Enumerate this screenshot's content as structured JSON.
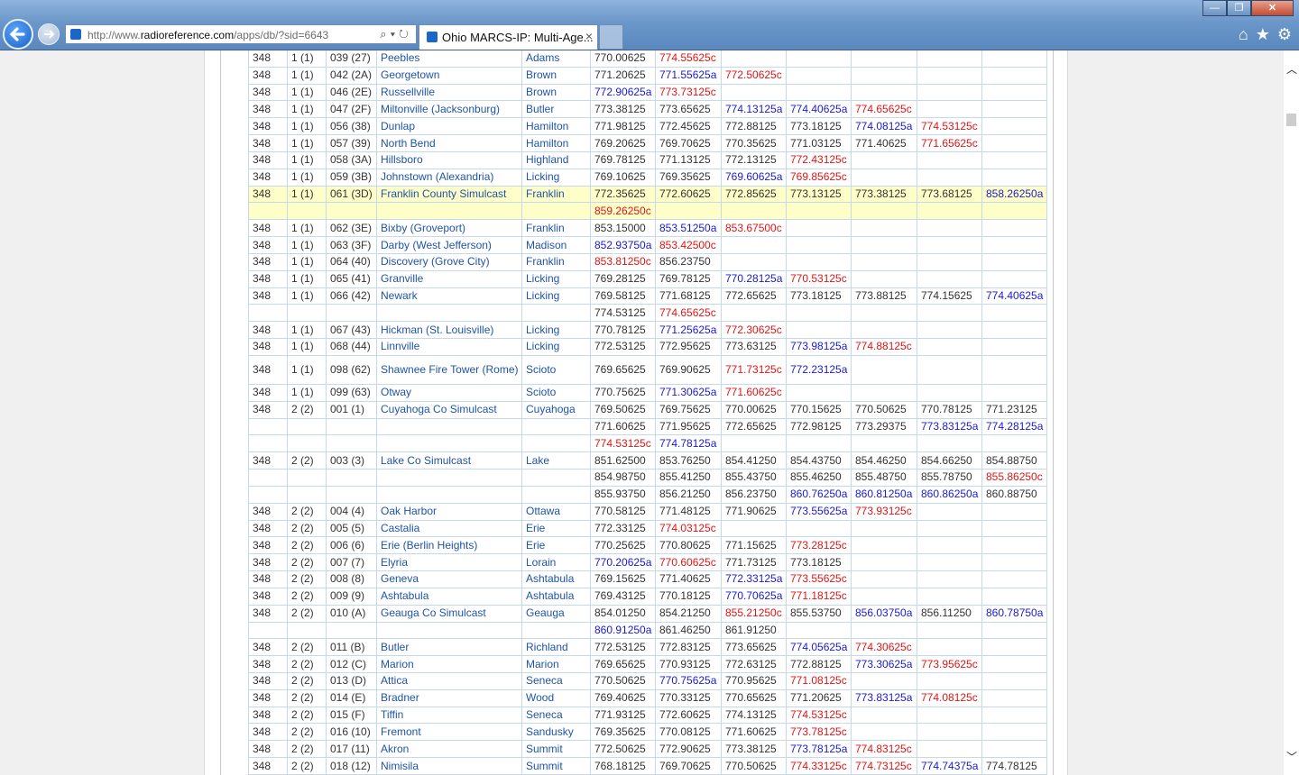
{
  "browser": {
    "url_prefix": "http://www.",
    "url_domain": "radioreference.com",
    "url_path": "/apps/db/?sid=6643",
    "tab_title": "Ohio MARCS-IP: Multi-Age...",
    "tab_close": "×",
    "search_icon": "search-icon",
    "refresh_icon": "refresh-icon",
    "window_min": "—",
    "window_max": "❐",
    "window_close": "✕",
    "tools": {
      "home": "⌂",
      "favorites": "★",
      "settings": "⚙"
    }
  },
  "table_rows": [
    {
      "c": [
        "348",
        "1 (1)",
        "039 (27)",
        "Peebles",
        "Adams",
        "770.00625",
        "774.55625c",
        "",
        "",
        "",
        "",
        ""
      ]
    },
    {
      "c": [
        "348",
        "1 (1)",
        "042 (2A)",
        "Georgetown",
        "Brown",
        "771.20625",
        "771.55625a",
        "772.50625c",
        "",
        "",
        "",
        ""
      ]
    },
    {
      "c": [
        "348",
        "1 (1)",
        "046 (2E)",
        "Russellville",
        "Brown",
        "772.90625a",
        "773.73125c",
        "",
        "",
        "",
        "",
        ""
      ]
    },
    {
      "c": [
        "348",
        "1 (1)",
        "047 (2F)",
        "Miltonville (Jacksonburg)",
        "Butler",
        "773.38125",
        "773.65625",
        "774.13125a",
        "774.40625a",
        "774.65625c",
        "",
        ""
      ]
    },
    {
      "c": [
        "348",
        "1 (1)",
        "056 (38)",
        "Dunlap",
        "Hamilton",
        "771.98125",
        "772.45625",
        "772.88125",
        "773.18125",
        "774.08125a",
        "774.53125c",
        ""
      ]
    },
    {
      "c": [
        "348",
        "1 (1)",
        "057 (39)",
        "North Bend",
        "Hamilton",
        "769.20625",
        "769.70625",
        "770.35625",
        "771.03125",
        "771.40625",
        "771.65625c",
        ""
      ]
    },
    {
      "c": [
        "348",
        "1 (1)",
        "058 (3A)",
        "Hillsboro",
        "Highland",
        "769.78125",
        "771.13125",
        "772.13125",
        "772.43125c",
        "",
        "",
        ""
      ]
    },
    {
      "c": [
        "348",
        "1 (1)",
        "059 (3B)",
        "Johnstown (Alexandria)",
        "Licking",
        "769.10625",
        "769.35625",
        "769.60625a",
        "769.85625c",
        "",
        "",
        ""
      ]
    },
    {
      "hl": true,
      "c": [
        "348",
        "1 (1)",
        "061 (3D)",
        "Franklin County Simulcast",
        "Franklin",
        "772.35625",
        "772.60625",
        "772.85625",
        "773.13125",
        "773.38125",
        "773.68125",
        "858.26250a"
      ]
    },
    {
      "hl": true,
      "c": [
        "",
        "",
        "",
        "",
        "",
        "859.26250c",
        "",
        "",
        "",
        "",
        "",
        ""
      ]
    },
    {
      "c": [
        "348",
        "1 (1)",
        "062 (3E)",
        "Bixby (Groveport)",
        "Franklin",
        "853.15000",
        "853.51250a",
        "853.67500c",
        "",
        "",
        "",
        ""
      ]
    },
    {
      "c": [
        "348",
        "1 (1)",
        "063 (3F)",
        "Darby (West Jefferson)",
        "Madison",
        "852.93750a",
        "853.42500c",
        "",
        "",
        "",
        "",
        ""
      ]
    },
    {
      "c": [
        "348",
        "1 (1)",
        "064 (40)",
        "Discovery (Grove City)",
        "Franklin",
        "853.81250c",
        "856.23750",
        "",
        "",
        "",
        "",
        ""
      ]
    },
    {
      "c": [
        "348",
        "1 (1)",
        "065 (41)",
        "Granville",
        "Licking",
        "769.28125",
        "769.78125",
        "770.28125a",
        "770.53125c",
        "",
        "",
        ""
      ]
    },
    {
      "c": [
        "348",
        "1 (1)",
        "066 (42)",
        "Newark",
        "Licking",
        "769.58125",
        "771.68125",
        "772.65625",
        "773.18125",
        "773.88125",
        "774.15625",
        "774.40625a"
      ]
    },
    {
      "c": [
        "",
        "",
        "",
        "",
        "",
        "774.53125",
        "774.65625c",
        "",
        "",
        "",
        "",
        ""
      ]
    },
    {
      "c": [
        "348",
        "1 (1)",
        "067 (43)",
        "Hickman (St. Louisville)",
        "Licking",
        "770.78125",
        "771.25625a",
        "772.30625c",
        "",
        "",
        "",
        ""
      ]
    },
    {
      "c": [
        "348",
        "1 (1)",
        "068 (44)",
        "Linnville",
        "Licking",
        "772.53125",
        "772.95625",
        "773.63125",
        "773.98125a",
        "774.88125c",
        "",
        ""
      ]
    },
    {
      "tall": true,
      "c": [
        "348",
        "1 (1)",
        "098 (62)",
        "Shawnee Fire Tower (Rome)",
        "Scioto",
        "769.65625",
        "769.90625",
        "771.73125c",
        "772.23125a",
        "",
        "",
        ""
      ]
    },
    {
      "c": [
        "348",
        "1 (1)",
        "099 (63)",
        "Otway",
        "Scioto",
        "770.75625",
        "771.30625a",
        "771.60625c",
        "",
        "",
        "",
        ""
      ]
    },
    {
      "c": [
        "348",
        "2 (2)",
        "001 (1)",
        "Cuyahoga Co Simulcast",
        "Cuyahoga",
        "769.50625",
        "769.75625",
        "770.00625",
        "770.15625",
        "770.50625",
        "770.78125",
        "771.23125"
      ]
    },
    {
      "c": [
        "",
        "",
        "",
        "",
        "",
        "771.60625",
        "771.95625",
        "772.65625",
        "772.98125",
        "773.29375",
        "773.83125a",
        "774.28125a"
      ]
    },
    {
      "c": [
        "",
        "",
        "",
        "",
        "",
        "774.53125c",
        "774.78125a",
        "",
        "",
        "",
        "",
        ""
      ]
    },
    {
      "c": [
        "348",
        "2 (2)",
        "003 (3)",
        "Lake Co Simulcast",
        "Lake",
        "851.62500",
        "853.76250",
        "854.41250",
        "854.43750",
        "854.46250",
        "854.66250",
        "854.88750"
      ]
    },
    {
      "c": [
        "",
        "",
        "",
        "",
        "",
        "854.98750",
        "855.41250",
        "855.43750",
        "855.46250",
        "855.48750",
        "855.78750",
        "855.86250c"
      ]
    },
    {
      "c": [
        "",
        "",
        "",
        "",
        "",
        "855.93750",
        "856.21250",
        "856.23750",
        "860.76250a",
        "860.81250a",
        "860.86250a",
        "860.88750"
      ]
    },
    {
      "c": [
        "348",
        "2 (2)",
        "004 (4)",
        "Oak Harbor",
        "Ottawa",
        "770.58125",
        "771.48125",
        "771.90625",
        "773.55625a",
        "773.93125c",
        "",
        ""
      ]
    },
    {
      "c": [
        "348",
        "2 (2)",
        "005 (5)",
        "Castalia",
        "Erie",
        "772.33125",
        "774.03125c",
        "",
        "",
        "",
        "",
        ""
      ]
    },
    {
      "c": [
        "348",
        "2 (2)",
        "006 (6)",
        "Erie (Berlin Heights)",
        "Erie",
        "770.25625",
        "770.80625",
        "771.15625",
        "773.28125c",
        "",
        "",
        ""
      ]
    },
    {
      "c": [
        "348",
        "2 (2)",
        "007 (7)",
        "Elyria",
        "Lorain",
        "770.20625a",
        "770.60625c",
        "771.73125",
        "773.18125",
        "",
        "",
        ""
      ]
    },
    {
      "c": [
        "348",
        "2 (2)",
        "008 (8)",
        "Geneva",
        "Ashtabula",
        "769.15625",
        "771.40625",
        "772.33125a",
        "773.55625c",
        "",
        "",
        ""
      ]
    },
    {
      "c": [
        "348",
        "2 (2)",
        "009 (9)",
        "Ashtabula",
        "Ashtabula",
        "769.43125",
        "770.18125",
        "770.70625a",
        "771.18125c",
        "",
        "",
        ""
      ]
    },
    {
      "c": [
        "348",
        "2 (2)",
        "010 (A)",
        "Geauga Co Simulcast",
        "Geauga",
        "854.01250",
        "854.21250",
        "855.21250c",
        "855.53750",
        "856.03750a",
        "856.11250",
        "860.78750a"
      ]
    },
    {
      "c": [
        "",
        "",
        "",
        "",
        "",
        "860.91250a",
        "861.46250",
        "861.91250",
        "",
        "",
        "",
        ""
      ]
    },
    {
      "c": [
        "348",
        "2 (2)",
        "011 (B)",
        "Butler",
        "Richland",
        "772.53125",
        "772.83125",
        "773.65625",
        "774.05625a",
        "774.30625c",
        "",
        ""
      ]
    },
    {
      "c": [
        "348",
        "2 (2)",
        "012 (C)",
        "Marion",
        "Marion",
        "769.65625",
        "770.93125",
        "772.63125",
        "772.88125",
        "773.30625a",
        "773.95625c",
        ""
      ]
    },
    {
      "c": [
        "348",
        "2 (2)",
        "013 (D)",
        "Attica",
        "Seneca",
        "770.50625",
        "770.75625a",
        "770.95625",
        "771.08125c",
        "",
        "",
        ""
      ]
    },
    {
      "c": [
        "348",
        "2 (2)",
        "014 (E)",
        "Bradner",
        "Wood",
        "769.40625",
        "770.33125",
        "770.65625",
        "771.20625",
        "773.83125a",
        "774.08125c",
        ""
      ]
    },
    {
      "c": [
        "348",
        "2 (2)",
        "015 (F)",
        "Tiffin",
        "Seneca",
        "771.93125",
        "772.60625",
        "774.13125",
        "774.53125c",
        "",
        "",
        ""
      ]
    },
    {
      "c": [
        "348",
        "2 (2)",
        "016 (10)",
        "Fremont",
        "Sandusky",
        "769.35625",
        "770.08125",
        "771.60625",
        "773.78125c",
        "",
        "",
        ""
      ]
    },
    {
      "c": [
        "348",
        "2 (2)",
        "017 (11)",
        "Akron",
        "Summit",
        "772.50625",
        "772.90625",
        "773.38125",
        "773.78125a",
        "774.83125c",
        "",
        ""
      ]
    },
    {
      "c": [
        "348",
        "2 (2)",
        "018 (12)",
        "Nimisila",
        "Summit",
        "768.18125",
        "769.70625",
        "770.50625",
        "774.33125c",
        "774.73125c",
        "774.74375a",
        "774.78125"
      ]
    }
  ]
}
